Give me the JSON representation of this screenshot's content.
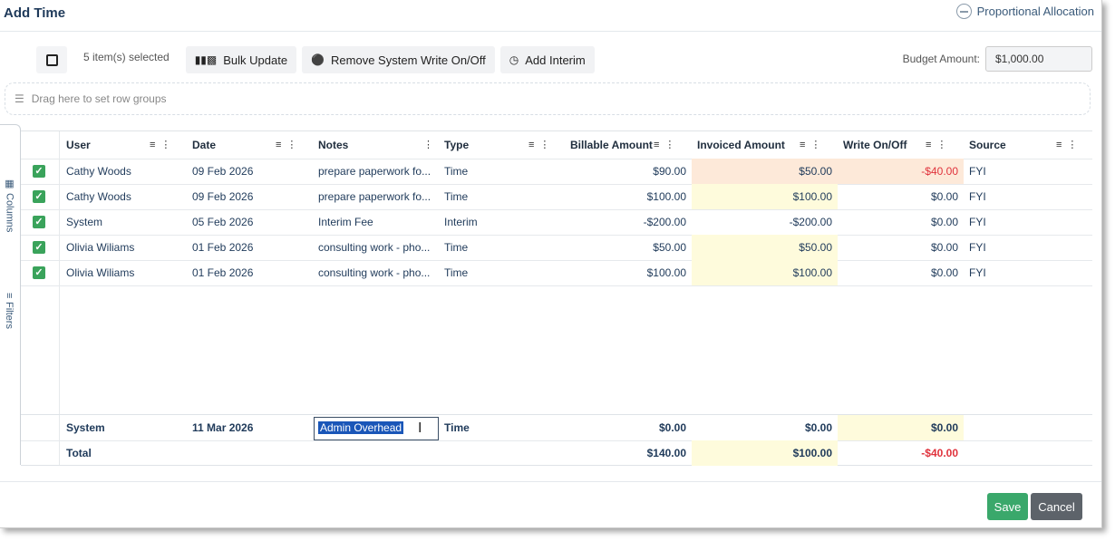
{
  "dialog": {
    "title": "Add Time",
    "proportional_allocation": "Proportional Allocation"
  },
  "toolbar": {
    "selected_text": "5 item(s) selected",
    "bulk_update": "Bulk Update",
    "remove_write": "Remove System Write On/Off",
    "add_interim": "Add Interim",
    "budget_label": "Budget Amount:",
    "budget_value": "$1,000.00"
  },
  "row_groups_placeholder": "Drag here to set row groups",
  "side_tabs": {
    "columns": "Columns",
    "filters": "Filters"
  },
  "columns": {
    "user": "User",
    "date": "Date",
    "notes": "Notes",
    "type": "Type",
    "billable": "Billable Amount",
    "invoiced": "Invoiced Amount",
    "write": "Write On/Off",
    "source": "Source"
  },
  "rows": [
    {
      "user": "Cathy Woods",
      "date": "09 Feb 2026",
      "notes": "prepare paperwork fo...",
      "type": "Time",
      "billable": "$90.00",
      "invoiced": "$50.00",
      "write": "-$40.00",
      "source": "FYI"
    },
    {
      "user": "Cathy Woods",
      "date": "09 Feb 2026",
      "notes": "prepare paperwork fo...",
      "type": "Time",
      "billable": "$100.00",
      "invoiced": "$100.00",
      "write": "$0.00",
      "source": "FYI"
    },
    {
      "user": "System",
      "date": "05 Feb 2026",
      "notes": "Interim Fee",
      "type": "Interim",
      "billable": "-$200.00",
      "invoiced": "-$200.00",
      "write": "$0.00",
      "source": "FYI"
    },
    {
      "user": "Olivia Wiliams",
      "date": "01 Feb 2026",
      "notes": "consulting work - pho...",
      "type": "Time",
      "billable": "$50.00",
      "invoiced": "$50.00",
      "write": "$0.00",
      "source": "FYI"
    },
    {
      "user": "Olivia Wiliams",
      "date": "01 Feb 2026",
      "notes": "consulting work - pho...",
      "type": "Time",
      "billable": "$100.00",
      "invoiced": "$100.00",
      "write": "$0.00",
      "source": "FYI"
    }
  ],
  "system_row": {
    "user": "System",
    "date": "11 Mar 2026",
    "notes_value": "Admin Overhead",
    "type": "Time",
    "billable": "$0.00",
    "invoiced": "$0.00",
    "write": "$0.00"
  },
  "total_row": {
    "label": "Total",
    "billable": "$140.00",
    "invoiced": "$100.00",
    "write": "-$40.00"
  },
  "footer": {
    "save": "Save",
    "cancel": "Cancel"
  },
  "colors": {
    "accent_green": "#3aa35b",
    "negative_red": "#e0323c",
    "peach": "#fde9d9",
    "yellow": "#fefbdc"
  }
}
